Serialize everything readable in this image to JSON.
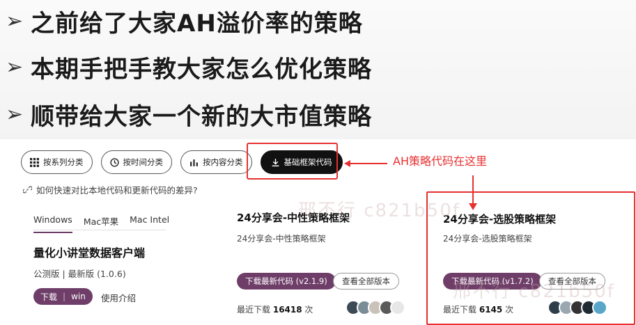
{
  "headlines": [
    {
      "bullet": "➢",
      "text": "之前给了大家AH溢价率的策略"
    },
    {
      "bullet": "➢",
      "text": "本期手把手教大家怎么优化策略"
    },
    {
      "bullet": "➢",
      "text": "顺带给大家一个新的大市值策略"
    }
  ],
  "tabs": {
    "by_series": "按系列分类",
    "by_time": "按时间分类",
    "by_content": "按内容分类",
    "base_code": "基础框架代码"
  },
  "annotation": {
    "text": "AH策略代码在这里"
  },
  "diff_link": "如何快速对比本地代码和更新代码的差异?",
  "os_tabs": [
    "Windows",
    "Mac苹果",
    "Mac Intel"
  ],
  "client": {
    "title": "量化小讲堂数据客户端",
    "version": "公测版 | 最新版 (1.0.6)",
    "download": "下载",
    "platform": "win",
    "usage": "使用介绍"
  },
  "cards": [
    {
      "title": "24分享会-中性策略框架",
      "subtitle": "24分享会-中性策略框架",
      "download": "下载最新代码 (v2.1.9)",
      "all_versions": "查看全部版本",
      "recent_label": "最近下载",
      "recent_count": "16418",
      "recent_unit": "次"
    },
    {
      "title": "24分享会-选股策略框架",
      "subtitle": "24分享会-选股策略框架",
      "download": "下载最新代码 (v1.7.2)",
      "all_versions": "查看全部版本",
      "recent_label": "最近下载",
      "recent_count": "6145",
      "recent_unit": "次"
    }
  ],
  "watermark": "邢不行 c821b50f",
  "colors": {
    "accent": "#6e3e69",
    "annotation": "#e83030"
  }
}
